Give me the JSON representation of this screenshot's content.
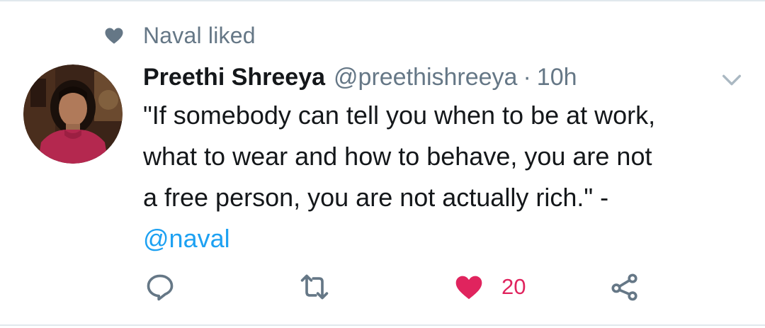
{
  "social_context": {
    "text": "Naval liked",
    "icon": "heart-icon",
    "color": "#657786"
  },
  "tweet": {
    "author_name": "Preethi Shreeya",
    "handle": "@preethishreeya",
    "separator": "·",
    "time": "10h",
    "text_lines": [
      "\"If somebody can tell you when to be at work,",
      "what to wear and how to behave, you are not",
      "a free person, you are not actually rich.\" -"
    ],
    "mention": "@naval",
    "menu_icon": "chevron-down-icon"
  },
  "actions": {
    "reply": {
      "icon": "reply-icon"
    },
    "retweet": {
      "icon": "retweet-icon"
    },
    "like": {
      "icon": "heart-icon",
      "count": "20",
      "liked": true,
      "color": "#e0245e"
    },
    "share": {
      "icon": "share-icon"
    }
  },
  "colors": {
    "link": "#1da1f2",
    "secondary_text": "#657786",
    "primary_text": "#14171a",
    "like": "#e0245e"
  }
}
